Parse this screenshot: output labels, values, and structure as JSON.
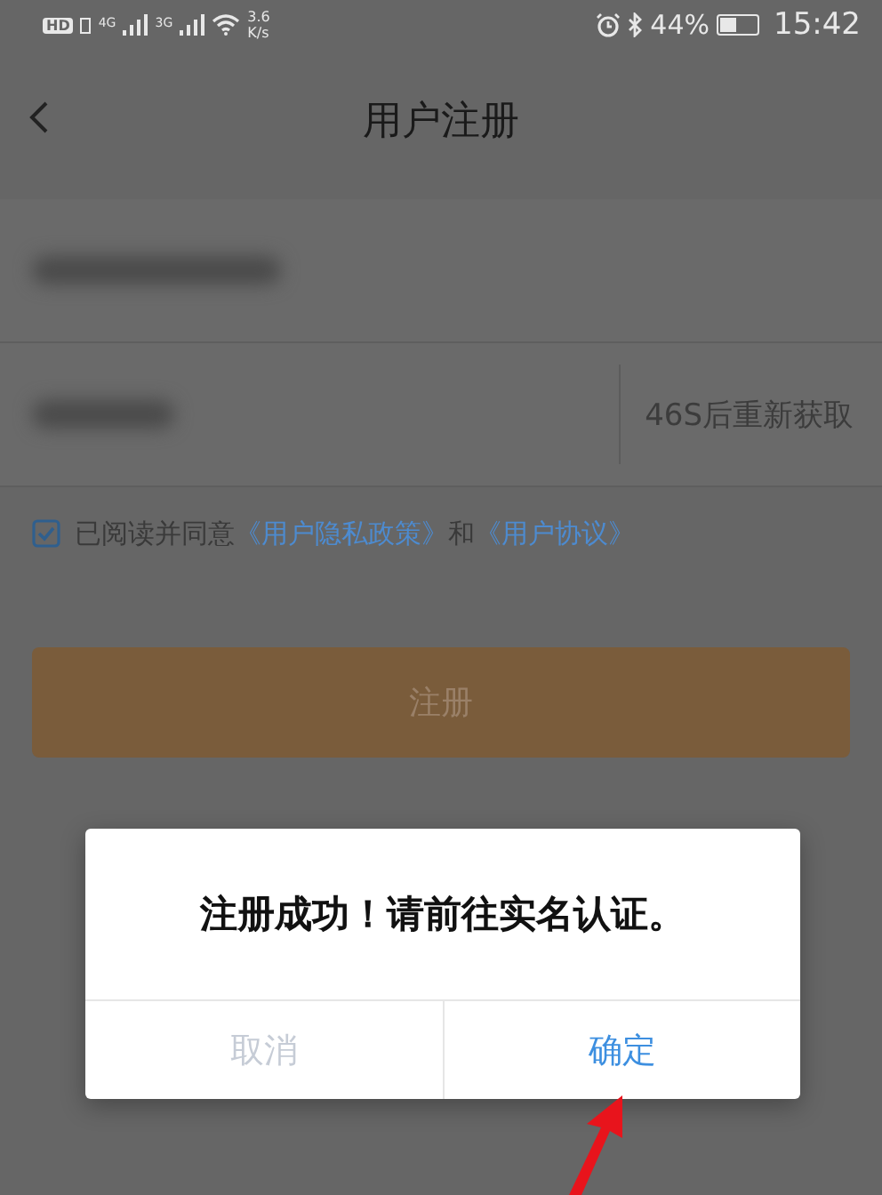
{
  "status_bar": {
    "hd": "HD",
    "sim1": "4G",
    "sim2": "3G",
    "speed": "3.6",
    "speed_unit": "K/s",
    "battery": "44%",
    "time": "15:42"
  },
  "header": {
    "title": "用户注册"
  },
  "phone_field": {
    "redacted": true
  },
  "code_field": {
    "redacted": true,
    "resend": "46S后重新获取"
  },
  "agreement": {
    "checked": true,
    "parts": [
      {
        "text": "已阅读并同意",
        "kind": "text"
      },
      {
        "text": "《用户隐私政策》",
        "kind": "link"
      },
      {
        "text": "和",
        "kind": "text"
      },
      {
        "text": "《用户协议》",
        "kind": "link"
      }
    ]
  },
  "register_button": {
    "label": "注册"
  },
  "dialog": {
    "message": "注册成功！请前往实名认证。",
    "buttons": [
      {
        "label": "取消",
        "kind": "cancel"
      },
      {
        "label": "确定",
        "kind": "confirm"
      }
    ]
  },
  "annotation": {
    "kind": "arrow"
  }
}
